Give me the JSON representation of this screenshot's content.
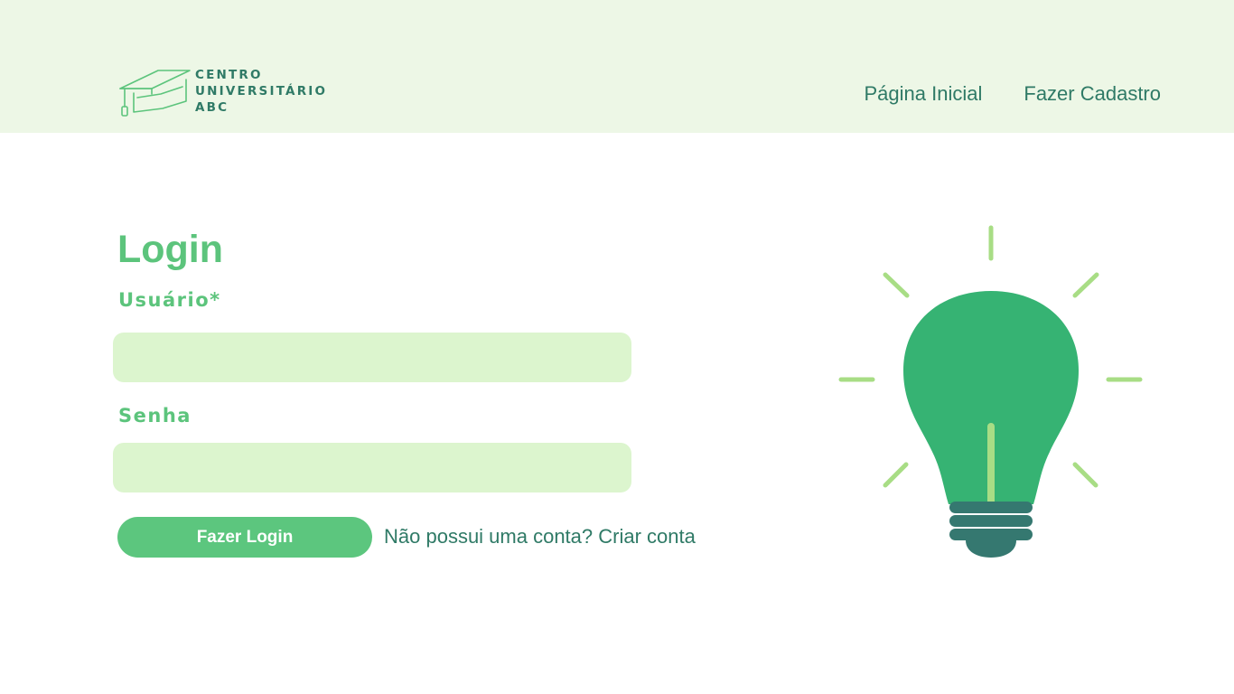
{
  "header": {
    "logo": {
      "icon": "graduation-cap-icon",
      "lines": [
        "CENTRO",
        "UNIVERSITÁRIO",
        "ABC"
      ]
    },
    "nav": {
      "home_label": "Página Inicial",
      "register_label": "Fazer Cadastro"
    }
  },
  "main": {
    "title": "Login",
    "username": {
      "label": "Usuário*",
      "value": "",
      "placeholder": ""
    },
    "password": {
      "label": "Senha",
      "value": "",
      "placeholder": ""
    },
    "submit_label": "Fazer Login",
    "signup_prompt": "Não possui uma conta?",
    "signup_link": "Criar conta"
  },
  "illustration": {
    "icon": "lightbulb-icon"
  },
  "colors": {
    "header_bg": "#edf7e6",
    "accent_green": "#5cc47c",
    "dark_teal": "#2f7a66",
    "field_bg": "#dcf5ce",
    "bulb_green": "#36b373",
    "bulb_base": "#357870",
    "ray_green": "#a8dd85"
  }
}
